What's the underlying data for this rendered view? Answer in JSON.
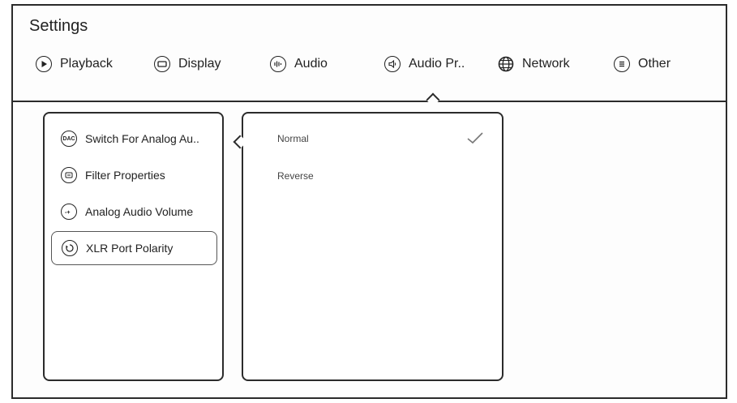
{
  "window": {
    "title": "Settings"
  },
  "tabs": [
    {
      "label": "Playback",
      "icon": "play-icon"
    },
    {
      "label": "Display",
      "icon": "display-icon"
    },
    {
      "label": "Audio",
      "icon": "audio-icon"
    },
    {
      "label": "Audio Pr..",
      "icon": "speaker-icon",
      "active": true
    },
    {
      "label": "Network",
      "icon": "globe-icon"
    },
    {
      "label": "Other",
      "icon": "list-icon"
    }
  ],
  "menu": {
    "items": [
      {
        "label": "Switch For Analog Au..",
        "icon": "dac-icon",
        "badge": "DAC"
      },
      {
        "label": "Filter Properties",
        "icon": "filter-icon"
      },
      {
        "label": "Analog Audio Volume",
        "icon": "volume-icon"
      },
      {
        "label": "XLR Port Polarity",
        "icon": "polarity-icon",
        "active": true
      }
    ]
  },
  "options": {
    "items": [
      {
        "label": "Normal",
        "selected": true
      },
      {
        "label": "Reverse",
        "selected": false
      }
    ]
  }
}
